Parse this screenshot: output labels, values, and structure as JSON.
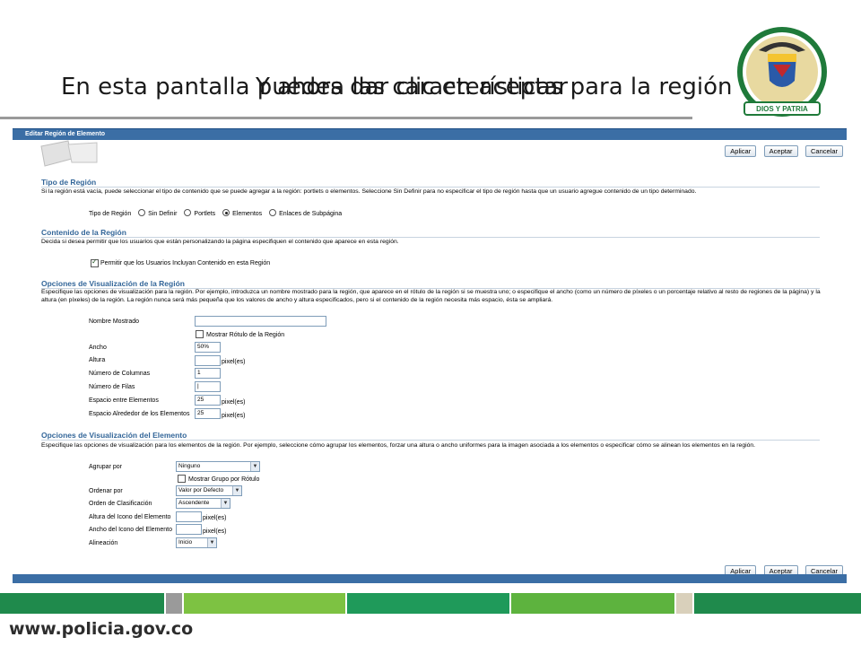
{
  "slide": {
    "title_line1": "En esta pantalla puedes dar clic en aceptar",
    "title_line2": "Y ahora las características para la región",
    "footer_url": "www.policia.gov.co",
    "badge_text_top": "REPÚBLICA DE COLOMBIA",
    "badge_text_mid": "POLICÍA • NACIONAL",
    "badge_text_bottom": "DIOS Y PATRIA"
  },
  "window": {
    "title": "Editar Región de Elemento"
  },
  "buttons": {
    "apply": "Aplicar",
    "accept": "Aceptar",
    "cancel": "Cancelar"
  },
  "region_type": {
    "heading": "Tipo de Región",
    "description": "Si la región está vacía, puede seleccionar el tipo de contenido que se puede agregar a la región: portlets o elementos. Seleccione Sin Definir para no especificar el tipo de región hasta que un usuario agregue contenido de un tipo determinado.",
    "label": "Tipo de Región",
    "options": [
      "Sin Definir",
      "Portlets",
      "Elementos",
      "Enlaces de Subpágina"
    ],
    "selected": "Elementos"
  },
  "region_content": {
    "heading": "Contenido de la Región",
    "description": "Decida si desea permitir que los usuarios que están personalizando la página especifiquen el contenido que aparece en esta región.",
    "checkbox_label": "Permitir que los Usuarios Incluyan Contenido en esta Región",
    "checked": true
  },
  "region_display": {
    "heading": "Opciones de Visualización de la Región",
    "description": "Especifique las opciones de visualización para la región. Por ejemplo, introduzca un nombre mostrado para la región, que aparece en el rótulo de la región si se muestra uno; o especifique el ancho (como un número de píxeles o un porcentaje relativo al resto de regiones de la página) y la altura (en píxeles) de la región. La región nunca será más pequeña que los valores de ancho y altura especificados, pero si el contenido de la región necesita más espacio, ésta se ampliará.",
    "display_name_label": "Nombre Mostrado",
    "display_name_value": "",
    "show_label_checkbox": "Mostrar Rótulo de la Región",
    "width_label": "Ancho",
    "width_value": "50%",
    "height_label": "Altura",
    "height_value": "",
    "columns_label": "Número de Columnas",
    "columns_value": "1",
    "rows_label": "Número de Filas",
    "rows_value": "|",
    "item_spacing_label": "Espacio entre Elementos",
    "item_spacing_value": "25",
    "around_spacing_label": "Espacio Alrededor de los Elementos",
    "around_spacing_value": "25",
    "unit": "pixel(es)"
  },
  "item_display": {
    "heading": "Opciones de Visualización del Elemento",
    "description": "Especifique las opciones de visualización para los elementos de la región. Por ejemplo, seleccione cómo agrupar los elementos, forzar una altura o ancho uniformes para la imagen asociada a los elementos o especificar cómo se alinean los elementos en la región.",
    "group_by_label": "Agrupar por",
    "group_by_value": "Ninguno",
    "show_group_label_checkbox": "Mostrar Grupo por Rótulo",
    "sort_by_label": "Ordenar por",
    "sort_by_value": "Valor por Defecto",
    "sort_order_label": "Orden de Clasificación",
    "sort_order_value": "Ascendente",
    "icon_height_label": "Altura del Icono del Elemento",
    "icon_width_label": "Ancho del Icono del Elemento",
    "alignment_label": "Alineación",
    "alignment_value": "Inicio",
    "unit": "pixel(es)"
  },
  "colors": {
    "header_blue": "#3b6ea5",
    "section_heading": "#336699",
    "footer_green_dark": "#1f8a4c",
    "footer_green_light": "#7dc242"
  }
}
